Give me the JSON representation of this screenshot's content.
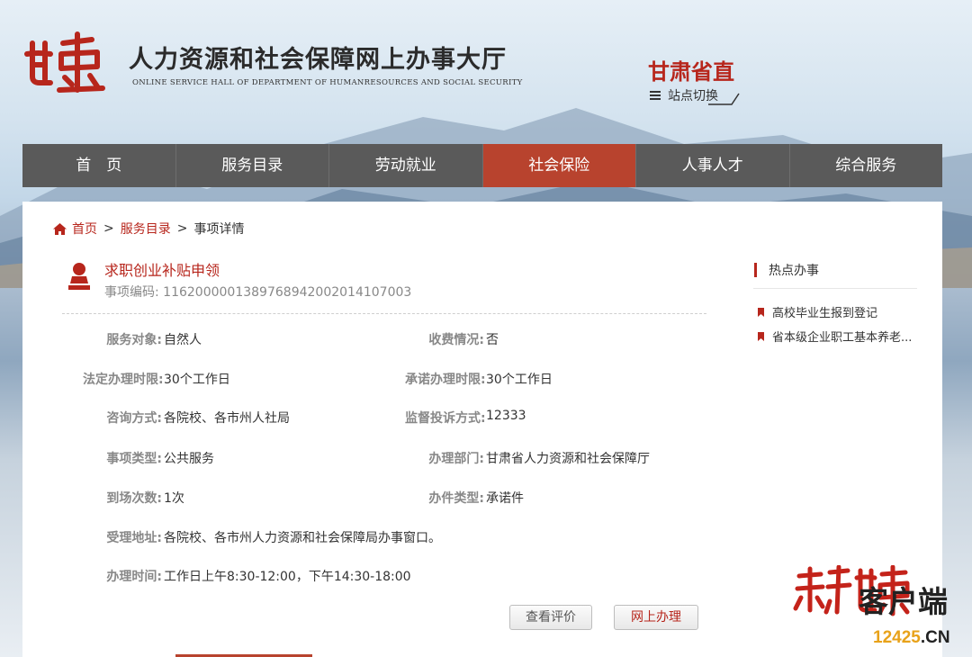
{
  "header": {
    "title": "人力资源和社会保障网上办事大厅",
    "subtitle": "ONLINE SERVICE HALL OF DEPARTMENT OF HUMANRESOURCES AND SOCIAL SECURITY",
    "logo_text": "甘肃",
    "region": "甘肃省直",
    "switch_label": "站点切换"
  },
  "nav": {
    "items": [
      "首　页",
      "服务目录",
      "劳动就业",
      "社会保险",
      "人事人才",
      "综合服务"
    ],
    "active": "社会保险"
  },
  "breadcrumb": {
    "home": "首页",
    "catalog": "服务目录",
    "current": "事项详情",
    "separator": ">"
  },
  "item": {
    "title": "求职创业补贴申领",
    "code_label": "事项编码:",
    "code": "11620000013897689420020141070​03"
  },
  "details": {
    "service_target": {
      "label": "服务对象:",
      "value": "自然人"
    },
    "fee": {
      "label": "收费情况:",
      "value": "否"
    },
    "legal_time": {
      "label": "法定办理时限:",
      "value": "30个工作日"
    },
    "promised_time": {
      "label": "承诺办理时限:",
      "value": "30个工作日"
    },
    "consult": {
      "label": "咨询方式:",
      "value": "各院校、各市州人社局"
    },
    "complaint": {
      "label": "监督投诉方式:",
      "value": "12333"
    },
    "item_type": {
      "label": "事项类型:",
      "value": "公共服务"
    },
    "department": {
      "label": "办理部门:",
      "value": "甘肃省人力资源和社会保障厅"
    },
    "visits": {
      "label": "到场次数:",
      "value": "1次"
    },
    "doc_type": {
      "label": "办件类型:",
      "value": "承诺件"
    },
    "address": {
      "label": "受理地址:",
      "value": "各院校、各市州人力资源和社会保障局办事窗口。"
    },
    "hours": {
      "label": "办理时间:",
      "value": "工作日上午8:30-12:00，下午14:30-18:00"
    }
  },
  "buttons": {
    "view_reviews": "查看评价",
    "online_apply": "网上办理"
  },
  "hot": {
    "title": "热点办事",
    "items": [
      "高校毕业生报到登记",
      "省本级企业职工基本养老..."
    ]
  },
  "watermark": {
    "logo_text": "新甘肃",
    "app_text": "客户端",
    "site": "12425",
    "site_suffix": ".CN"
  },
  "colors": {
    "accent": "#b7261c",
    "nav_bg": "#5a5a5a",
    "nav_active": "#b8432e"
  }
}
